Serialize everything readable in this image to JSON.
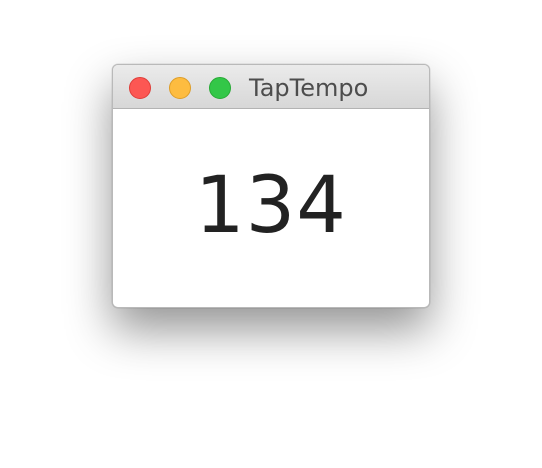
{
  "window": {
    "title": "TapTempo"
  },
  "display": {
    "tempo_value": "134"
  },
  "icons": {
    "close": "close-window-icon",
    "minimize": "minimize-window-icon",
    "zoom": "zoom-window-icon"
  },
  "colors": {
    "close": "#fc5753",
    "minimize": "#fdbc40",
    "zoom": "#33c748"
  }
}
